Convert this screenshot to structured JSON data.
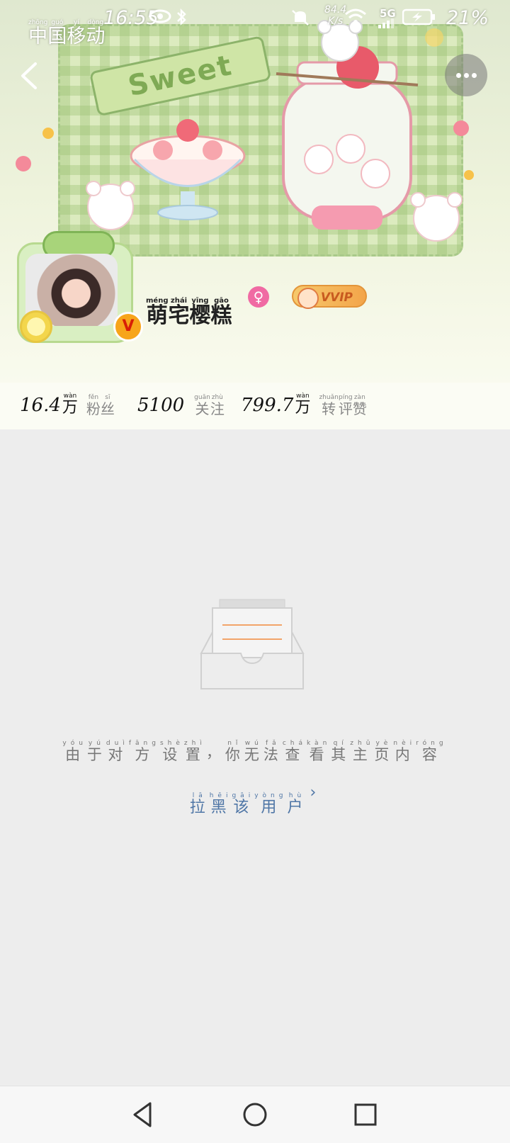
{
  "status_bar": {
    "carrier": "中国移动",
    "carrier_pinyin": [
      "zhōng",
      "guó",
      "yí",
      "dòng"
    ],
    "time": "16:55",
    "net_speed": "84.4",
    "net_speed_unit": "K/s",
    "network": "5G",
    "battery": "21%"
  },
  "profile": {
    "banner_text": "Sweet",
    "username": [
      "萌",
      "宅",
      "樱",
      "糕"
    ],
    "username_pinyin": [
      "méng",
      "zhái",
      "yīng",
      "gāo"
    ],
    "gender_symbol": "♀",
    "vip_badge": "VVIP",
    "verified_badge": "V"
  },
  "stats": [
    {
      "value": "16.4",
      "unit": "万",
      "unit_pinyin": "wàn",
      "label": [
        "粉",
        "丝"
      ],
      "label_pinyin": [
        "fěn",
        "sī"
      ]
    },
    {
      "value": "5100",
      "unit": "",
      "unit_pinyin": "",
      "label": [
        "关",
        "注"
      ],
      "label_pinyin": [
        "guān",
        "zhù"
      ]
    },
    {
      "value": "799.7",
      "unit": "万",
      "unit_pinyin": "wàn",
      "label": [
        "转",
        "评",
        "赞"
      ],
      "label_pinyin": [
        "zhuǎn",
        "píng",
        "zàn"
      ]
    }
  ],
  "empty_state": {
    "message": [
      "由",
      "于",
      "对",
      "方",
      "设",
      "置",
      "，",
      "你",
      "无",
      "法",
      "查",
      "看",
      "其",
      "主",
      "页",
      "内",
      "容"
    ],
    "message_pinyin": [
      "yóu",
      "yú",
      "duì",
      "fāng",
      "shè",
      "zhì",
      "",
      "nǐ",
      "wú",
      "fǎ",
      "chá",
      "kàn",
      "qí",
      "zhǔ",
      "yè",
      "nèi",
      "róng"
    ],
    "action": [
      "拉",
      "黑",
      "该",
      "用",
      "户"
    ],
    "action_pinyin": [
      "lā",
      "hēi",
      "gāi",
      "yòng",
      "hù"
    ],
    "action_chevron": "›"
  },
  "icons": {
    "back": "back-arrow-icon",
    "more": "more-dots-icon",
    "eye": "eye-icon",
    "bluetooth": "bluetooth-icon",
    "mute": "bell-mute-icon",
    "wifi": "wifi-icon",
    "signal": "signal-icon",
    "battery": "battery-charging-icon"
  },
  "colors": {
    "link": "#4f76a6",
    "banner_green": "#dcebbf",
    "vip_orange": "#f3a54a",
    "gender_pink": "#f06aa3"
  }
}
